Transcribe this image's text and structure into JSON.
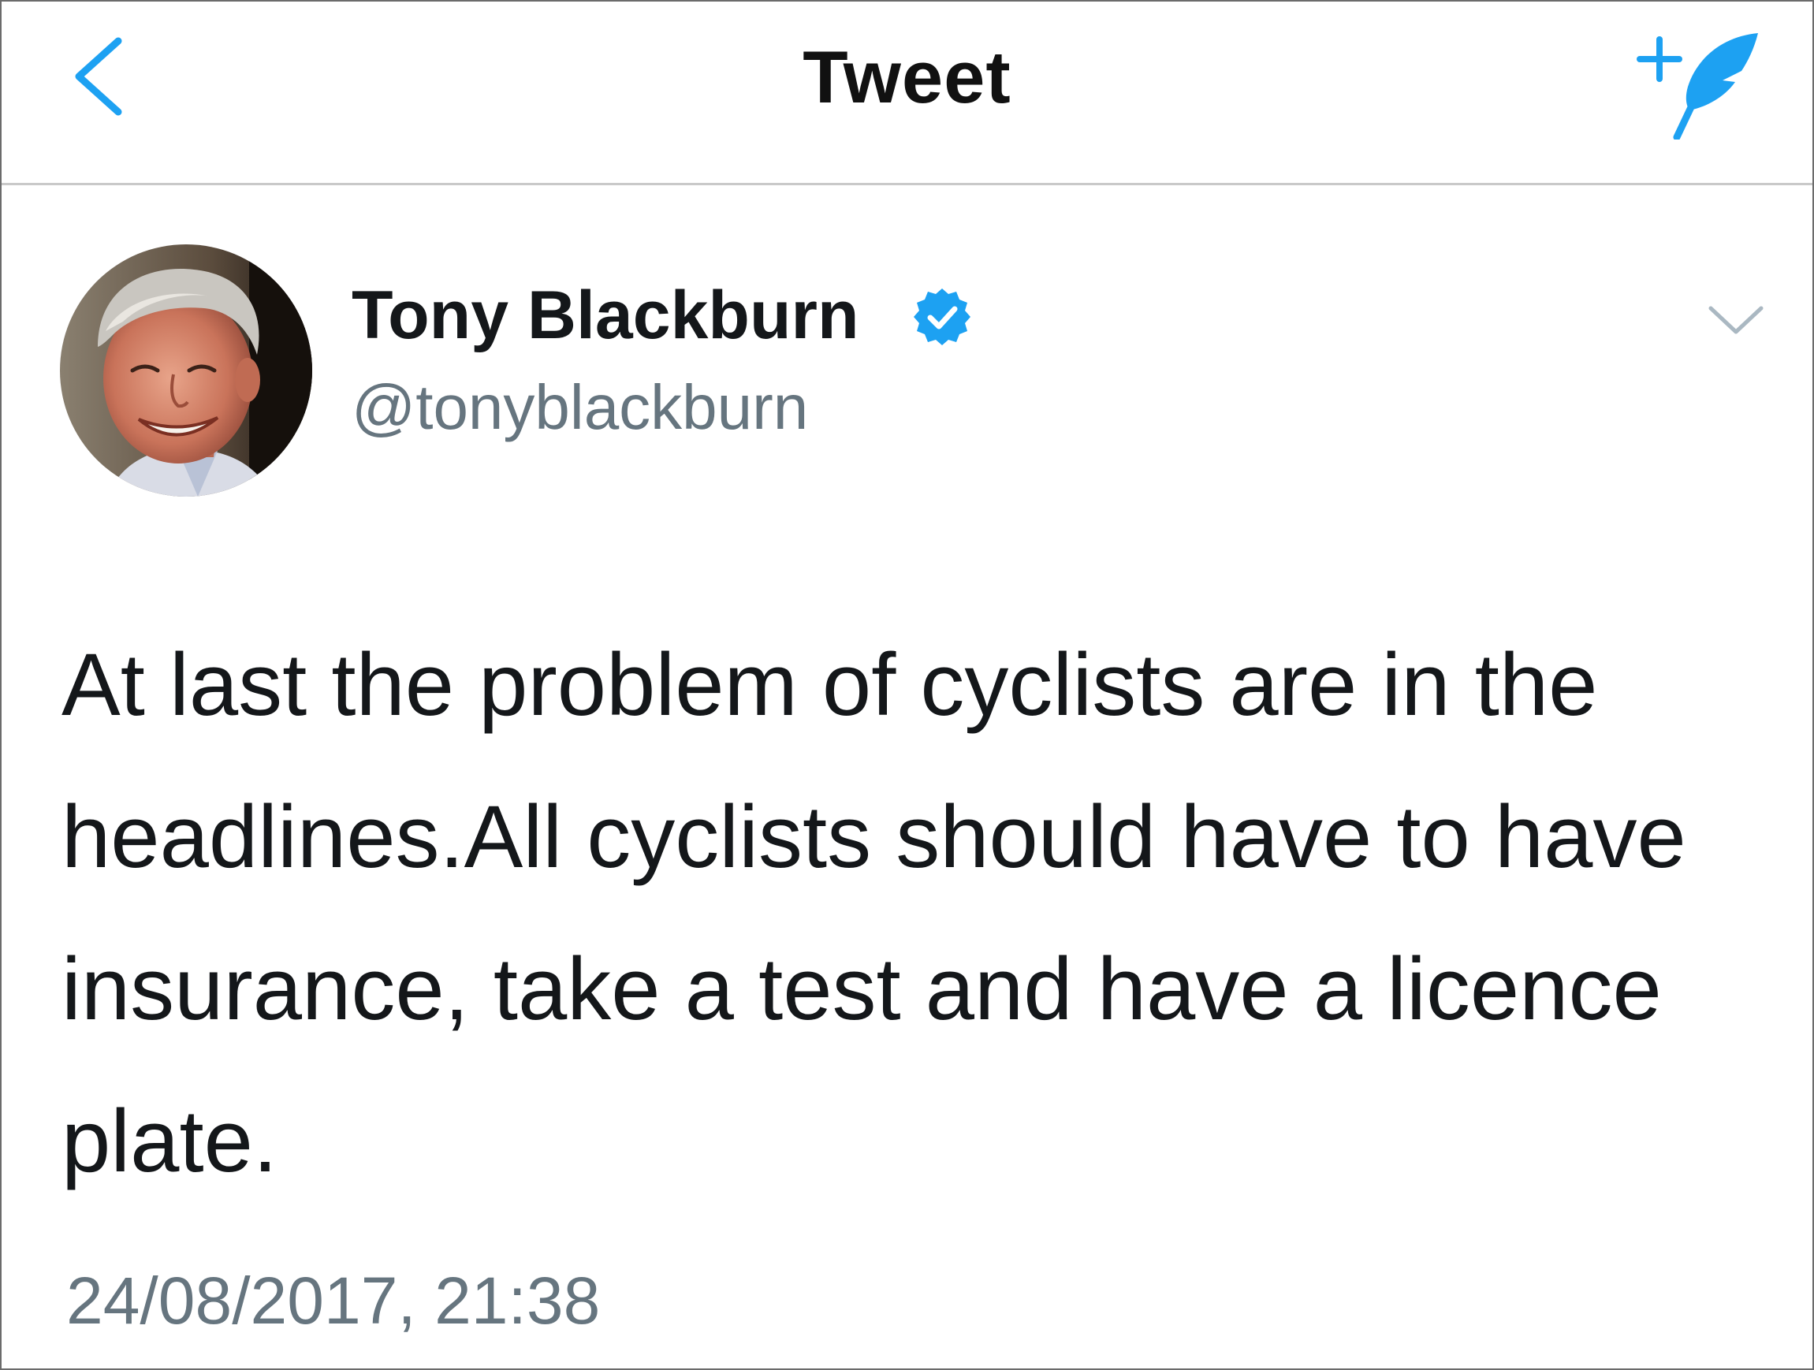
{
  "nav": {
    "back_icon": "chevron-left-icon",
    "title": "Tweet",
    "compose_icon": "compose-tweet-icon"
  },
  "tweet": {
    "author": {
      "display_name": "Tony Blackburn",
      "verified": true,
      "handle": "@tonyblackburn"
    },
    "text": "At last the problem of cyclists are in the headlines.All cyclists should have to have insurance, take a test and have a licence plate.",
    "timestamp": "24/08/2017, 21:38",
    "menu_icon": "chevron-down-icon"
  },
  "colors": {
    "accent": "#1da1f2",
    "text_primary": "#14171a",
    "text_secondary": "#66757f",
    "divider": "#c9c9c9"
  }
}
